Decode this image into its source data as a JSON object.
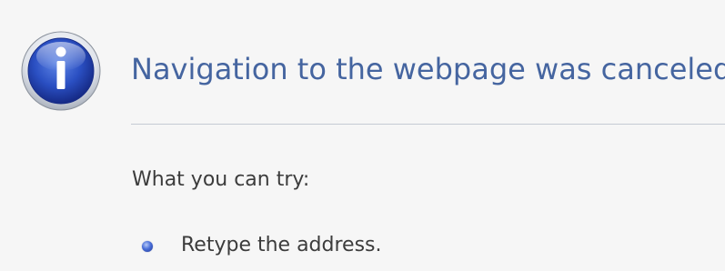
{
  "error_page": {
    "title": "Navigation to the webpage was canceled",
    "try_label": "What you can try:",
    "suggestions": [
      "Retype the address."
    ],
    "icon": "info-icon",
    "bullet_icon": "bullet-icon"
  }
}
